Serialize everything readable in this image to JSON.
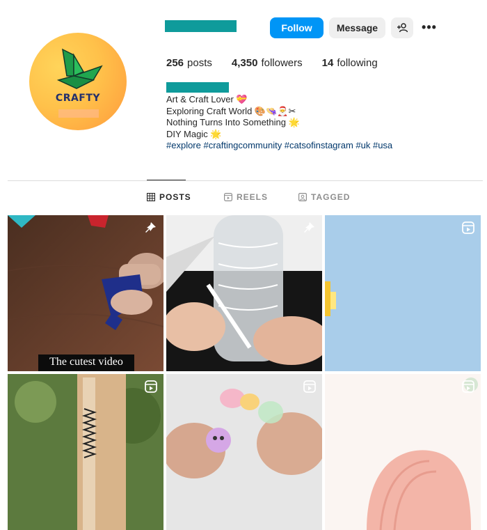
{
  "profile": {
    "logo_text": "CRAFTY",
    "stats": {
      "posts": {
        "count": "256",
        "label": "posts"
      },
      "followers": {
        "count": "4,350",
        "label": "followers"
      },
      "following": {
        "count": "14",
        "label": "following"
      }
    },
    "bio": [
      "Art & Craft Lover 💝",
      "Exploring Craft World 🎨👒🎅✂",
      "Nothing Turns Into Something 🌟",
      "DIY Magic 🌟"
    ],
    "hashtags": "#explore #craftingcommunity #catsofinstagram #uk #usa"
  },
  "actions": {
    "follow": "Follow",
    "message": "Message",
    "more": "•••"
  },
  "tabs": [
    {
      "label": "POSTS",
      "active": true
    },
    {
      "label": "REELS",
      "active": false
    },
    {
      "label": "TAGGED",
      "active": false
    }
  ],
  "posts": [
    {
      "type": "pinned",
      "caption": "The cutest video"
    },
    {
      "type": "pinned"
    },
    {
      "type": "reel"
    },
    {
      "type": "reel"
    },
    {
      "type": "reel"
    },
    {
      "type": "reel"
    }
  ],
  "colors": {
    "accent": "#0095f6",
    "redacted": "#0f9b9b",
    "hashtag": "#00376b"
  }
}
